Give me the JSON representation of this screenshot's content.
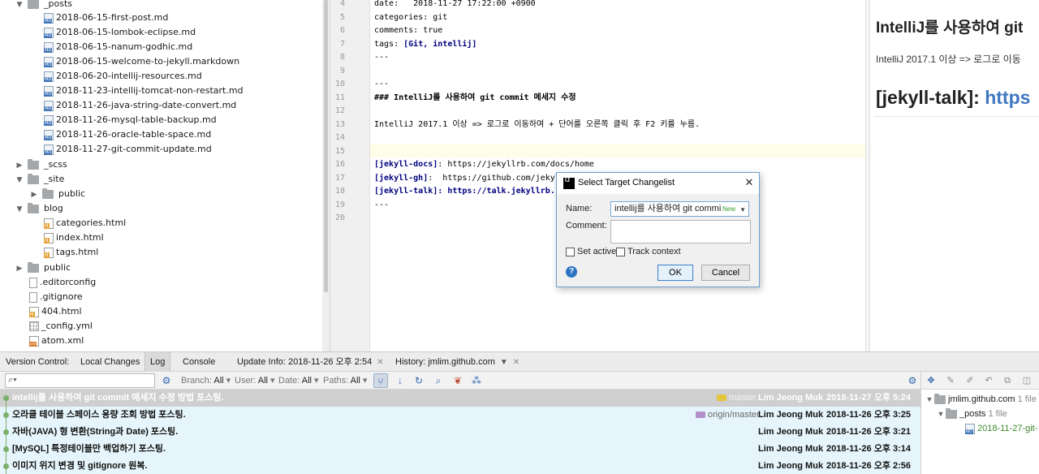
{
  "project_tree": {
    "posts_folder": "_posts",
    "posts": [
      "2018-06-15-first-post.md",
      "2018-06-15-lombok-eclipse.md",
      "2018-06-15-nanum-godhic.md",
      "2018-06-15-welcome-to-jekyll.markdown",
      "2018-06-20-intellij-resources.md",
      "2018-11-23-intellij-tomcat-non-restart.md",
      "2018-11-26-java-string-date-convert.md",
      "2018-11-26-mysql-table-backup.md",
      "2018-11-26-oracle-table-space.md",
      "2018-11-27-git-commit-update.md"
    ],
    "scss": "_scss",
    "site": "_site",
    "site_public": "public",
    "blog": "blog",
    "blog_files": [
      "categories.html",
      "index.html",
      "tags.html"
    ],
    "public": "public",
    "root_files": [
      ".editorconfig",
      ".gitignore",
      "404.html",
      "_config.yml",
      "atom.xml"
    ]
  },
  "editor": {
    "line_numbers": [
      "4",
      "5",
      "6",
      "7",
      "8",
      "9",
      "10",
      "11",
      "12",
      "13",
      "14",
      "15",
      "16",
      "17",
      "18",
      "19",
      "20"
    ],
    "date_line": "date:   2018-11-27 17:22:00 +0900",
    "categories_line": "categories: git",
    "comments_line": "comments: true",
    "tags_key": "tags:",
    "tags_value": "[Git, intellij]",
    "separator": "---",
    "heading_line": "### IntelliJ를 사용하여 git commit 메세지 수정",
    "body_line": "IntelliJ 2017.1 이상 => 로그로 이동하여 + 단어를 오른쪽 클릭 후 F2 키를 누름.",
    "link_docs_label": "[jekyll-docs]",
    "link_docs_url": ": https://jekyllrb.com/docs/home",
    "link_gh_label": "[jekyll-gh]",
    "link_gh_url": ":  https://github.com/jekyll/",
    "link_talk_label": "[jekyll-talk]",
    "link_talk_url": ": https://talk.jekyllrb."
  },
  "preview": {
    "heading": "IntelliJ를 사용하여 git",
    "paragraph": "IntelliJ 2017.1 이상 => 로그로 이동",
    "link_heading_label": "[jekyll-talk]:",
    "link_heading_url": "https"
  },
  "dialog": {
    "title": "Select Target Changelist",
    "name_label": "Name:",
    "name_value": "intellij를 사용하여 git commi",
    "new_badge": "New",
    "comment_label": "Comment:",
    "set_active_label": "Set active",
    "track_context_label": "Track context",
    "ok_label": "OK",
    "cancel_label": "Cancel",
    "help": "?"
  },
  "bottom": {
    "tabs": {
      "version_control": "Version Control:",
      "local_changes": "Local Changes",
      "log": "Log",
      "console": "Console",
      "update_info": "Update Info: 2018-11-26 오후 2:54",
      "history": "History: jmlim.github.com"
    },
    "filters": {
      "branch_label": "Branch:",
      "branch_value": "All",
      "user_label": "User:",
      "user_value": "All",
      "date_label": "Date:",
      "date_value": "All",
      "paths_label": "Paths:",
      "paths_value": "All"
    },
    "commits": [
      {
        "message": "intellij를 사용하여 git commit 메세지 수정 방법 포스팅.",
        "ref": "master",
        "author": "Lim Jeong Muk",
        "date": "2018-11-27 오후 5:24"
      },
      {
        "message": "오라클 테이블 스페이스 용량 조회 방법 포스팅.",
        "ref": "origin/master",
        "author": "Lim Jeong Muk",
        "date": "2018-11-26 오후 3:25"
      },
      {
        "message": "자바(JAVA) 형 변환(String과 Date) 포스팅.",
        "ref": "",
        "author": "Lim Jeong Muk",
        "date": "2018-11-26 오후 3:21"
      },
      {
        "message": "[MySQL] 특정테이블만 백업하기 포스팅.",
        "ref": "",
        "author": "Lim Jeong Muk",
        "date": "2018-11-26 오후 3:14"
      },
      {
        "message": "이미지 위지 변경 및 gitignore 원복.",
        "ref": "",
        "author": "Lim Jeong Muk",
        "date": "2018-11-26 오후 2:56"
      }
    ],
    "changes": {
      "repo": "jmlim.github.com",
      "repo_count": "1 file",
      "folder": "_posts",
      "folder_count": "1 file",
      "file": "2018-11-27-git-"
    }
  },
  "colors": {
    "selected_commit_bg": "#cfcfcf",
    "log_bg": "#e6f5fb",
    "link_blue": "#4078c0",
    "markdown_keyword": "#000080"
  }
}
